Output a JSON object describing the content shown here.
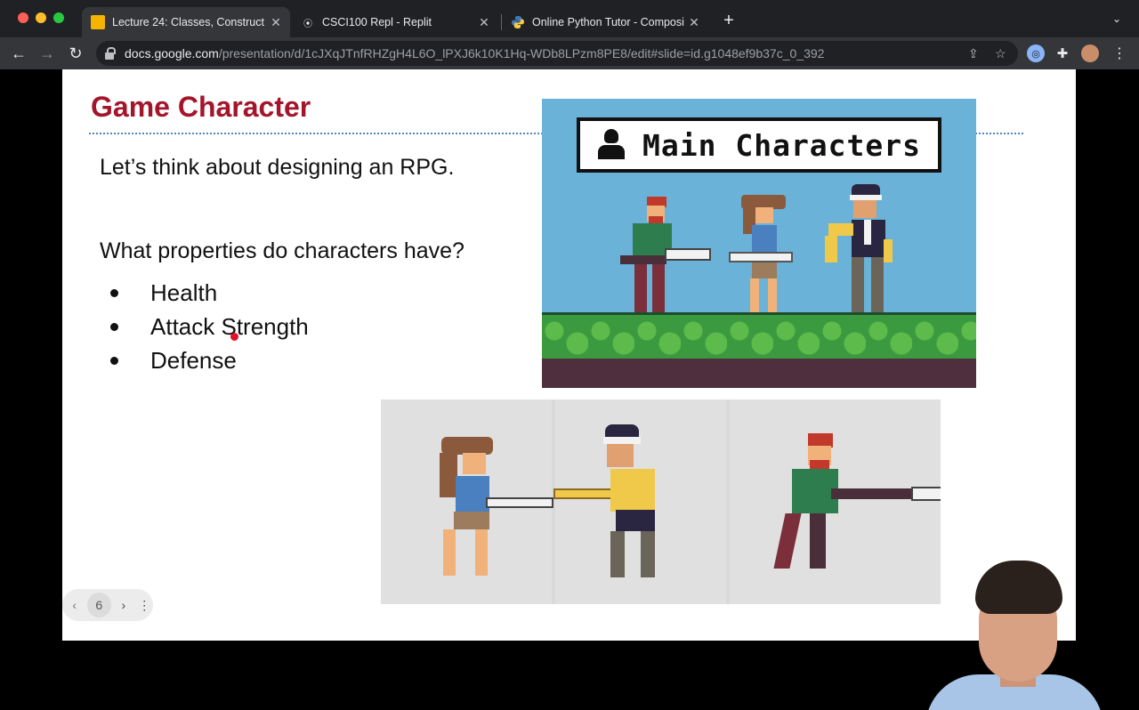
{
  "browser": {
    "tabs": [
      {
        "title": "Lecture 24: Classes, Construct",
        "icon": "slides-icon",
        "active": true
      },
      {
        "title": "CSCI100 Repl - Replit",
        "icon": "replit-icon",
        "active": false
      },
      {
        "title": "Online Python Tutor - Composi",
        "icon": "python-icon",
        "active": false
      }
    ],
    "url_domain": "docs.google.com",
    "url_path": "/presentation/d/1cJXqJTnfRHZgH4L6O_lPXJ6k10K1Hq-WDb8LPzm8PE8/edit#slide=id.g1048ef9b37c_0_392"
  },
  "slide": {
    "title": "Game Character",
    "intro": "Let’s think about designing an RPG.",
    "question": "What properties do characters have?",
    "bullets": [
      "Health",
      "Attack Strength",
      "Defense"
    ],
    "banner_text": "Main Characters"
  },
  "pager": {
    "current_page": "6"
  },
  "colors": {
    "title": "#a3152a",
    "dotline": "#4a86c8",
    "sky": "#6ab2d8",
    "grass": "#3b9a3f"
  }
}
